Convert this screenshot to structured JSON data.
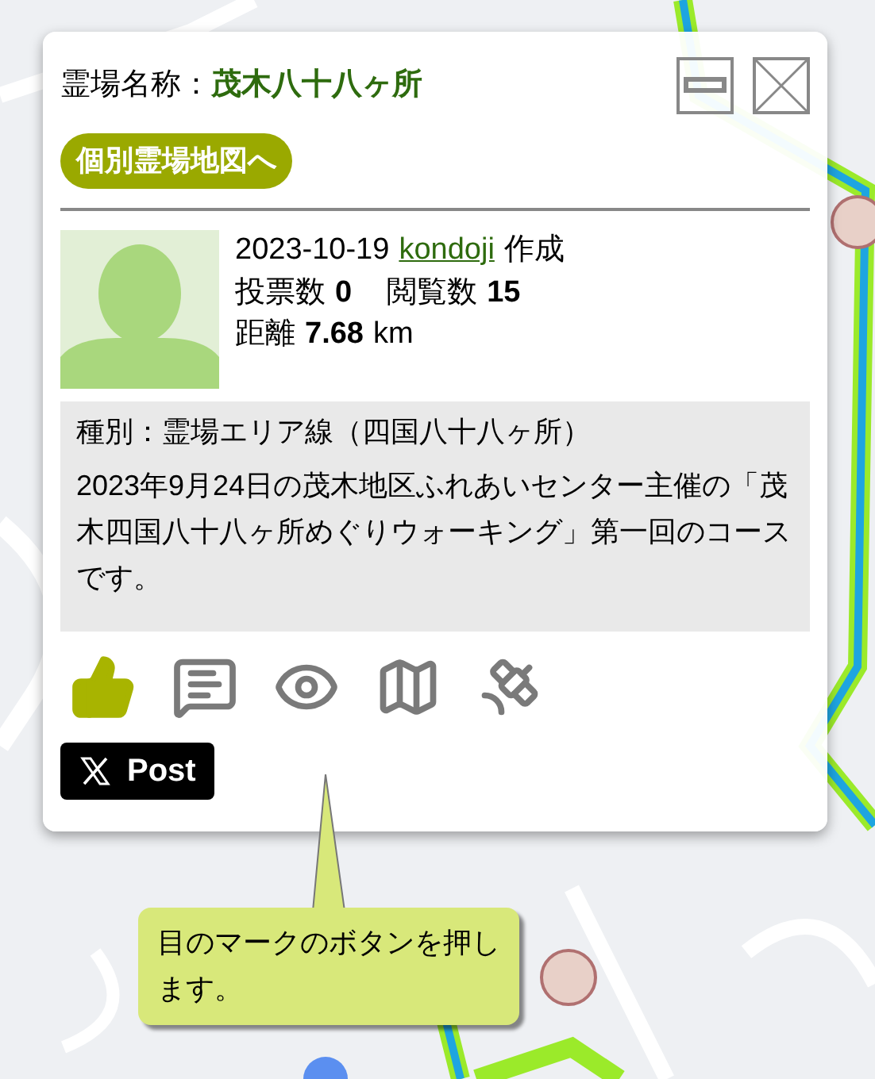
{
  "popup": {
    "label": "霊場名称：",
    "name": "茂木八十八ヶ所",
    "map_link": "個別霊場地図へ",
    "date": "2023-10-19",
    "author": "kondoji",
    "created": "作成",
    "votes_label": "投票数",
    "votes": "0",
    "views_label": "閲覧数",
    "views": "15",
    "distance_label": "距離",
    "distance": "7.68",
    "distance_unit": "km",
    "type": "種別：霊場エリア線（四国八十八ヶ所）",
    "description": "2023年9月24日の茂木地区ふれあいセンター主催の「茂木四国八十八ヶ所めぐりウォーキング」第一回のコースです。",
    "actions": [
      {
        "kind": "like"
      },
      {
        "kind": "comment"
      },
      {
        "kind": "view"
      },
      {
        "kind": "map"
      },
      {
        "kind": "satellite"
      }
    ],
    "post_button": "Post"
  },
  "callout": {
    "text": "目のマークのボタンを押します。"
  }
}
